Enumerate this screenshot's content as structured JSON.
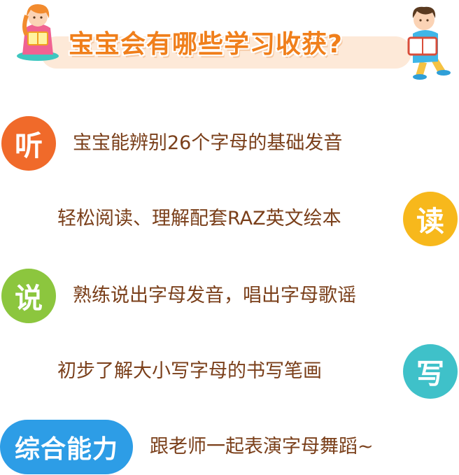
{
  "header": {
    "title": "宝宝会有哪些学习收获?"
  },
  "colors": {
    "listen": "#f06a2a",
    "read": "#f7b81c",
    "speak": "#8cc63e",
    "write": "#3fc1c9",
    "overall": "#2d9de6",
    "text": "#7a3f1a",
    "title": "#f07f1b"
  },
  "items": [
    {
      "badge": "听",
      "text": "宝宝能辨别26个字母的基础发音"
    },
    {
      "badge": "读",
      "text": "轻松阅读、理解配套RAZ英文绘本"
    },
    {
      "badge": "说",
      "text": "熟练说出字母发音，唱出字母歌谣"
    },
    {
      "badge": "写",
      "text": "初步了解大小写字母的书写笔画"
    },
    {
      "badge": "综合能力",
      "text": "跟老师一起表演字母舞蹈~"
    }
  ]
}
